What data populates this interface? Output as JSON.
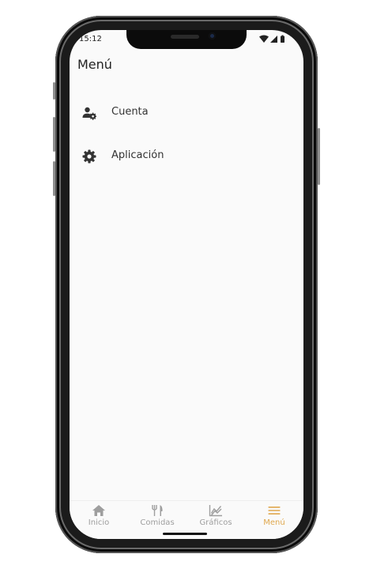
{
  "status_bar": {
    "time": "15:12",
    "icons": [
      "wifi-icon",
      "signal-icon",
      "battery-icon"
    ]
  },
  "header": {
    "title": "Menú"
  },
  "menu": {
    "items": [
      {
        "label": "Cuenta",
        "icon": "user-settings-icon"
      },
      {
        "label": "Aplicación",
        "icon": "gear-icon"
      }
    ]
  },
  "bottom_nav": {
    "items": [
      {
        "label": "Inicio",
        "icon": "home-icon",
        "active": false
      },
      {
        "label": "Comidas",
        "icon": "utensils-icon",
        "active": false
      },
      {
        "label": "Gráficos",
        "icon": "chart-icon",
        "active": false
      },
      {
        "label": "Menú",
        "icon": "menu-icon",
        "active": true
      }
    ]
  },
  "colors": {
    "accent": "#e0a84e",
    "inactive": "#9e9e9e",
    "text": "#222222",
    "screen_bg": "#fafafa"
  }
}
